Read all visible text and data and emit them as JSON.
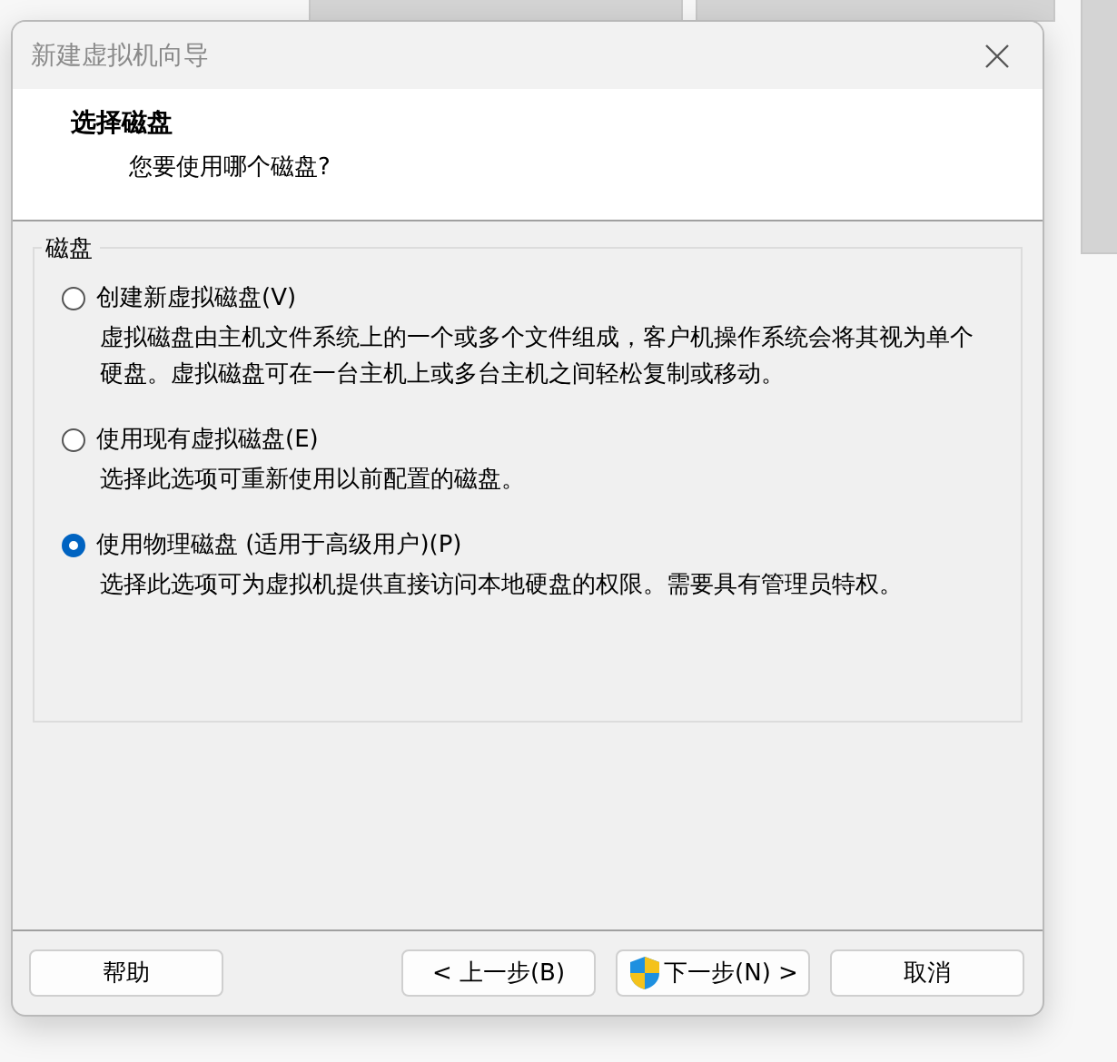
{
  "window": {
    "title": "新建虚拟机向导"
  },
  "header": {
    "title": "选择磁盘",
    "subtitle": "您要使用哪个磁盘?"
  },
  "group": {
    "label": "磁盘",
    "options": [
      {
        "label": "创建新虚拟磁盘(V)",
        "description": "虚拟磁盘由主机文件系统上的一个或多个文件组成，客户机操作系统会将其视为单个硬盘。虚拟磁盘可在一台主机上或多台主机之间轻松复制或移动。",
        "selected": false
      },
      {
        "label": "使用现有虚拟磁盘(E)",
        "description": "选择此选项可重新使用以前配置的磁盘。",
        "selected": false
      },
      {
        "label": "使用物理磁盘 (适用于高级用户)(P)",
        "description": "选择此选项可为虚拟机提供直接访问本地硬盘的权限。需要具有管理员特权。",
        "selected": true
      }
    ]
  },
  "buttons": [
    {
      "label": "帮助",
      "kind": "plain"
    },
    {
      "label": "< 上一步(B)",
      "kind": "plain"
    },
    {
      "label": "下一步(N) >",
      "kind": "shield"
    },
    {
      "label": "取消",
      "kind": "plain"
    }
  ]
}
